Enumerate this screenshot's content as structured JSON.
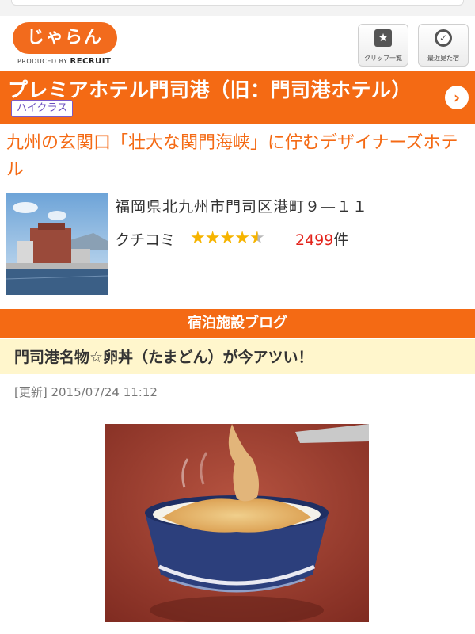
{
  "header": {
    "logo_text": "じゃらん",
    "produced_by": "PRODUCED BY",
    "brand": "RECRUIT",
    "clip_label": "クリップ一覧",
    "recent_label": "最近見た宿"
  },
  "hotel": {
    "name": "プレミアホテル門司港（旧：門司港ホテル）",
    "class_badge": "ハイクラス",
    "catchphrase": "九州の玄関口「壮大な関門海峡」に佇むデザイナーズホテル",
    "address": "福岡県北九州市門司区港町９—１１",
    "review_label": "クチコミ",
    "rating_stars": 4.5,
    "review_count": "2499",
    "review_unit": "件"
  },
  "blog": {
    "section_title": "宿泊施設ブログ",
    "post_title": "門司港名物☆卵丼（たまどん）が今アツい！",
    "updated": "[更新] 2015/07/24 11:12"
  },
  "colors": {
    "accent": "#f46a14",
    "badge": "#6a4fbf",
    "count": "#e3231b",
    "post_bg": "#fff6cc"
  },
  "icons": {
    "clip": "bookmark-star-icon",
    "recent": "clock-icon",
    "next": "chevron-right-icon"
  }
}
